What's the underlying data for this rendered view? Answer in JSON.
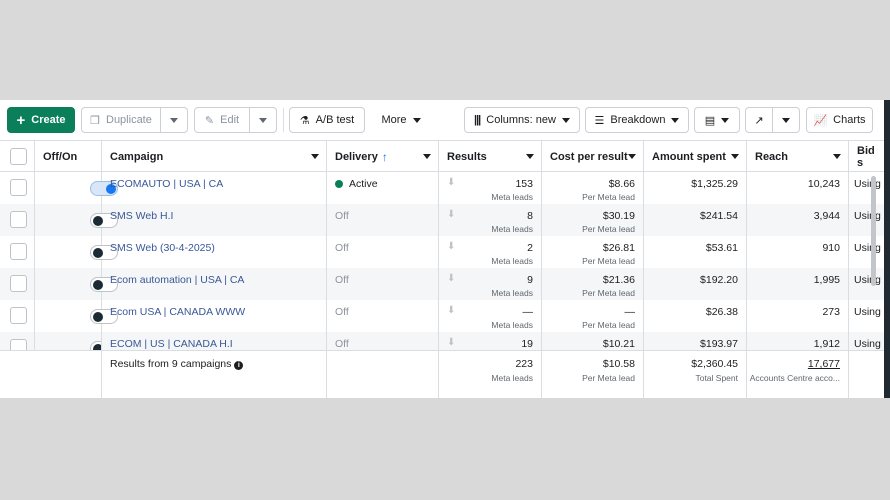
{
  "toolbar": {
    "create_label": "Create",
    "duplicate_label": "Duplicate",
    "edit_label": "Edit",
    "ab_test_label": "A/B test",
    "more_label": "More",
    "columns_label": "Columns: new",
    "breakdown_label": "Breakdown",
    "charts_label": "Charts"
  },
  "columns": {
    "off_on": "Off/On",
    "campaign": "Campaign",
    "delivery": "Delivery",
    "results": "Results",
    "cost_per_result": "Cost per result",
    "amount_spent": "Amount spent",
    "reach": "Reach",
    "bid": "Bid s"
  },
  "rows": [
    {
      "on": true,
      "campaign": "ECOMAUTO | USA | CA",
      "delivery": "Active",
      "results": "153",
      "results_sub": "Meta leads",
      "cost": "$8.66",
      "cost_sub": "Per Meta lead",
      "spent": "$1,325.29",
      "reach": "10,243",
      "bid": "Using"
    },
    {
      "on": false,
      "campaign": "SMS Web H.I",
      "delivery": "Off",
      "results": "8",
      "results_sub": "Meta leads",
      "cost": "$30.19",
      "cost_sub": "Per Meta lead",
      "spent": "$241.54",
      "reach": "3,944",
      "bid": "Using"
    },
    {
      "on": false,
      "campaign": "SMS Web (30-4-2025)",
      "delivery": "Off",
      "results": "2",
      "results_sub": "Meta leads",
      "cost": "$26.81",
      "cost_sub": "Per Meta lead",
      "spent": "$53.61",
      "reach": "910",
      "bid": "Using"
    },
    {
      "on": false,
      "campaign": "Ecom automation | USA | CA",
      "delivery": "Off",
      "results": "9",
      "results_sub": "Meta leads",
      "cost": "$21.36",
      "cost_sub": "Per Meta lead",
      "spent": "$192.20",
      "reach": "1,995",
      "bid": "Using"
    },
    {
      "on": false,
      "campaign": "Ecom USA | CANADA WWW",
      "delivery": "Off",
      "results": "—",
      "results_sub": "Meta leads",
      "cost": "—",
      "cost_sub": "Per Meta lead",
      "spent": "$26.38",
      "reach": "273",
      "bid": "Using"
    },
    {
      "on": false,
      "campaign": "ECOM | US | CANADA H.I",
      "delivery": "Off",
      "results": "19",
      "results_sub": "",
      "cost": "$10.21",
      "cost_sub": "",
      "spent": "$193.97",
      "reach": "1,912",
      "bid": "Using"
    }
  ],
  "footer": {
    "label": "Results from 9 campaigns",
    "results": "223",
    "results_sub": "Meta leads",
    "cost": "$10.58",
    "cost_sub": "Per Meta lead",
    "spent": "$2,360.45",
    "spent_sub": "Total Spent",
    "reach": "17,677",
    "reach_sub": "Accounts Centre acco..."
  },
  "colors": {
    "create": "#0a7f5a",
    "link": "#385898",
    "toggle_on": "#1877f2",
    "active_dot": "#0a7f5a"
  }
}
